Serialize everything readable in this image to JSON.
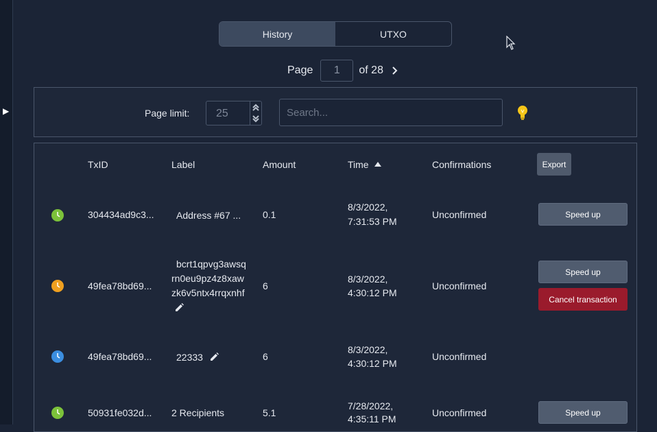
{
  "tabs": [
    {
      "label": "History",
      "active": true
    },
    {
      "label": "UTXO",
      "active": false
    }
  ],
  "pager": {
    "page_label": "Page",
    "current_page": "1",
    "of_label": "of 28"
  },
  "filters": {
    "page_limit_label": "Page limit:",
    "page_limit_value": "25",
    "search_placeholder": "Search..."
  },
  "table": {
    "headers": {
      "txid": "TxID",
      "label": "Label",
      "amount": "Amount",
      "time": "Time",
      "confirmations": "Confirmations"
    },
    "export_label": "Export",
    "rows": [
      {
        "status_color": "#7cc23a",
        "txid": "304434ad9c3...",
        "label_lines": [
          "Address #67 ..."
        ],
        "amount": "0.1",
        "time_date": "8/3/2022,",
        "time_clock": "7:31:53 PM",
        "confirmations": "Unconfirmed",
        "speed_up": "Speed up"
      },
      {
        "status_color": "#f0a020",
        "txid": "49fea78bd69...",
        "label_lines": [
          "bcrt1qpvg3awsq",
          "rn0eu9pz4z8xaw",
          "zk6v5ntx4rrqxnhf"
        ],
        "amount": "6",
        "time_date": "8/3/2022,",
        "time_clock": "4:30:12 PM",
        "confirmations": "Unconfirmed",
        "speed_up": "Speed up",
        "cancel": "Cancel transaction"
      },
      {
        "status_color": "#3b8ee0",
        "txid": "49fea78bd69...",
        "label_lines": [
          "22333"
        ],
        "amount": "6",
        "time_date": "8/3/2022,",
        "time_clock": "4:30:12 PM",
        "confirmations": "Unconfirmed"
      },
      {
        "status_color": "#7cc23a",
        "txid": "50931fe032d...",
        "label_lines": [
          "2 Recipients"
        ],
        "amount": "5.1",
        "time_date": "7/28/2022,",
        "time_clock": "4:35:11 PM",
        "confirmations": "Unconfirmed",
        "speed_up": "Speed up"
      }
    ]
  }
}
